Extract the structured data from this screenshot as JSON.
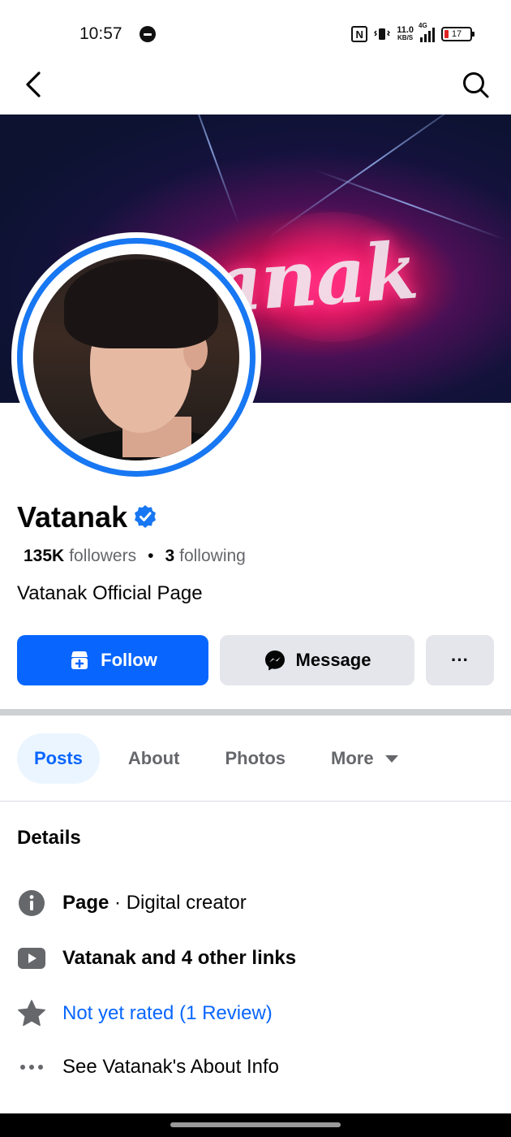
{
  "status_bar": {
    "time": "10:57",
    "nfc": "N",
    "net_speed_value": "11.0",
    "net_speed_unit": "KB/S",
    "network_type": "4G",
    "battery_level": "17",
    "battery_color": "#e02424"
  },
  "nav": {
    "back_icon": "chevron-left-icon",
    "search_icon": "search-icon"
  },
  "cover": {
    "text": "Vatanak"
  },
  "profile": {
    "name": "Vatanak",
    "verified": true,
    "verified_color": "#1877f2",
    "followers_count": "135K",
    "followers_label": "followers",
    "separator": "•",
    "following_count": "3",
    "following_label": "following",
    "intro": "Vatanak Official Page"
  },
  "actions": {
    "follow_label": "Follow",
    "message_label": "Message",
    "more_label": "···",
    "accent": "#0866ff"
  },
  "tabs": [
    {
      "label": "Posts",
      "active": true
    },
    {
      "label": "About",
      "active": false
    },
    {
      "label": "Photos",
      "active": false
    },
    {
      "label": "More",
      "active": false
    }
  ],
  "details": {
    "title": "Details",
    "rows": [
      {
        "icon": "info-icon",
        "bold": "Page",
        "text": " · Digital creator"
      },
      {
        "icon": "youtube-icon",
        "bold": "Vatanak and 4 other links",
        "text": ""
      },
      {
        "icon": "star-icon",
        "bold": "",
        "text": "Not yet rated (1 Review)"
      },
      {
        "icon": "more-dots-icon",
        "bold": "",
        "text": "See Vatanak's About Info"
      }
    ]
  }
}
